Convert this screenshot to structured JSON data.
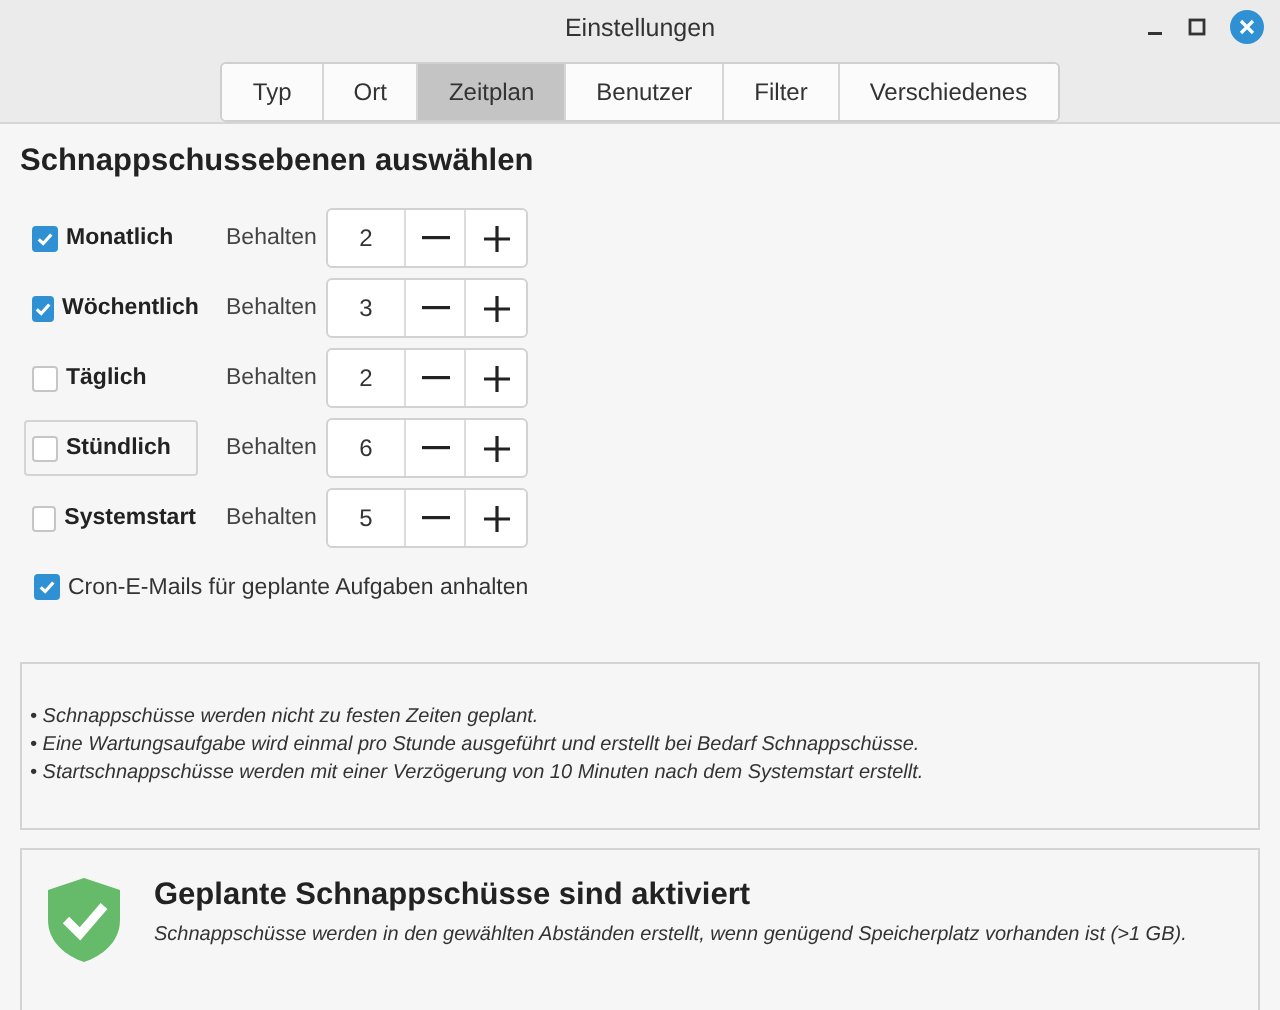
{
  "window": {
    "title": "Einstellungen"
  },
  "tabs": [
    {
      "label": "Typ",
      "selected": false
    },
    {
      "label": "Ort",
      "selected": false
    },
    {
      "label": "Zeitplan",
      "selected": true
    },
    {
      "label": "Benutzer",
      "selected": false
    },
    {
      "label": "Filter",
      "selected": false
    },
    {
      "label": "Verschiedenes",
      "selected": false
    }
  ],
  "section_title": "Schnappschussebenen auswählen",
  "levels": [
    {
      "label": "Monatlich",
      "checked": true,
      "focused": false,
      "keep_label": "Behalten",
      "count": "2"
    },
    {
      "label": "Wöchentlich",
      "checked": true,
      "focused": false,
      "keep_label": "Behalten",
      "count": "3"
    },
    {
      "label": "Täglich",
      "checked": false,
      "focused": false,
      "keep_label": "Behalten",
      "count": "2"
    },
    {
      "label": "Stündlich",
      "checked": false,
      "focused": true,
      "keep_label": "Behalten",
      "count": "6"
    },
    {
      "label": "Systemstart",
      "checked": false,
      "focused": false,
      "keep_label": "Behalten",
      "count": "5"
    }
  ],
  "cron_option": {
    "label": "Cron-E-Mails für geplante Aufgaben anhalten",
    "checked": true
  },
  "notes": [
    "• Schnappschüsse werden nicht zu festen Zeiten geplant.",
    "• Eine Wartungsaufgabe wird einmal pro Stunde ausgeführt und erstellt bei Bedarf Schnappschüsse.",
    "• Startschnappschüsse werden mit einer Verzögerung von 10 Minuten nach dem Systemstart erstellt."
  ],
  "status": {
    "kind": "ok",
    "title": "Geplante Schnappschüsse sind aktiviert",
    "message": "Schnappschüsse werden in den gewählten Abständen erstellt, wenn genügend Speicherplatz vorhanden ist (>1 GB)."
  }
}
